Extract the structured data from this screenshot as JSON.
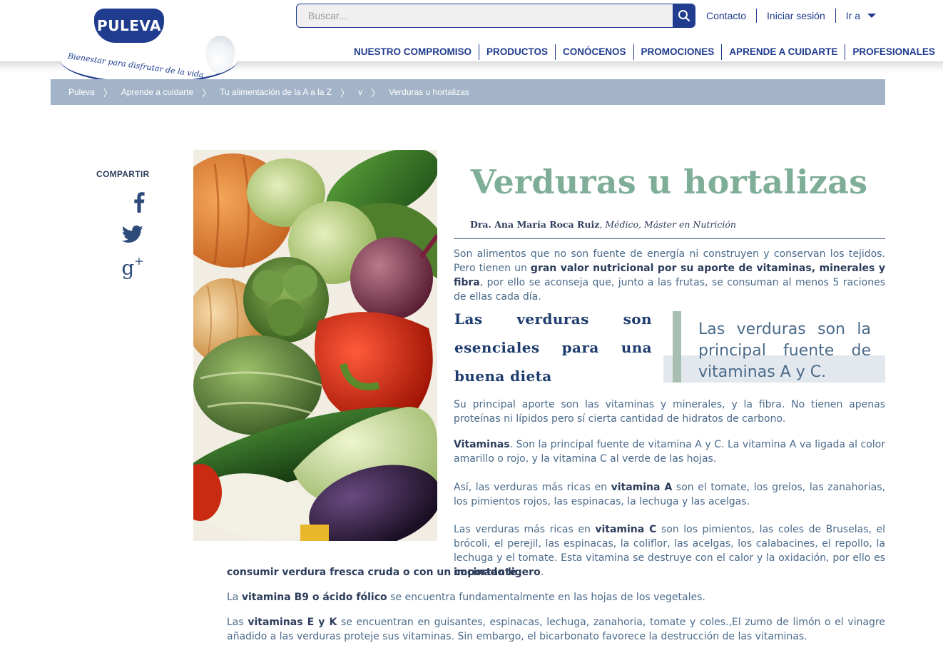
{
  "brand": {
    "logo_text": "PULEVA",
    "tagline": "Bienestar para disfrutar de la vida"
  },
  "search": {
    "placeholder": "Buscar..."
  },
  "top_links": [
    "Contacto",
    "Iniciar sesión",
    "Ir a"
  ],
  "nav": [
    "NUESTRO COMPROMISO",
    "PRODUCTOS",
    "CONÓCENOS",
    "PROMOCIONES",
    "APRENDE A CUIDARTE",
    "PROFESIONALES"
  ],
  "breadcrumb": [
    "Puleva",
    "Aprende a cuidarte",
    "Tu alimentación de la A a la Z",
    "v",
    "Verduras u hortalizas"
  ],
  "share": {
    "title": "COMPARTIR",
    "networks": [
      "facebook-icon",
      "twitter-icon",
      "google-plus-icon"
    ]
  },
  "article": {
    "title": "Verduras u hortalizas",
    "author_name": "Dra. Ana María Roca Ruiz",
    "author_role": ", Médico, Máster en Nutrición",
    "intro": {
      "a": "Son alimentos que no son fuente de energía ni construyen y conservan los tejidos. Pero tienen un ",
      "b": "gran valor nutricional por su aporte de vitaminas, minerales y fibra",
      "c": ", por ello se aconseja que, junto a las frutas, se consuman al menos 5 raciones de ellas cada día."
    },
    "subheading": "Las verduras son esenciales para una buena dieta",
    "quote": "Las verduras son la principal fuente de vitaminas A y C.",
    "p1": "Su principal aporte son las vitaminas y minerales, y la fibra. No tienen apenas proteínas ni lípidos pero sí cierta cantidad de hidratos de carbono.",
    "p2": {
      "b": "Vitaminas",
      "c": ". Son la principal fuente de vitamina A y C. La vitamina A va ligada al color amarillo o rojo, y la vitamina C al verde de las hojas."
    },
    "p3": {
      "a": "Así, las verduras más ricas en ",
      "b": "vitamina A",
      "c": " son el tomate, los grelos, las zanahorias, los pimientos rojos, las espinacas, la lechuga y las acelgas."
    },
    "p4": {
      "a": "Las verduras más ricas en ",
      "b": "vitamina C",
      "c": " son los pimientos, las coles de Bruselas, el brócoli, el perejil, las espinacas, la coliflor, las acelgas, los calabacines, el repollo, la lechuga y el tomate. Esta vitamina se destruye con el calor y la oxidación, por ello es ",
      "d": "importante",
      "e": "consumir verdura fresca cruda o con un cocinado ligero",
      "f": "."
    },
    "p5": {
      "a": "La ",
      "b": "vitamina B9 o ácido fólico",
      "c": " se encuentra fundamentalmente en las hojas de los vegetales."
    },
    "p6": {
      "a": "Las ",
      "b": "vitaminas E y K",
      "c": " se encuentran en guisantes, espinacas, lechuga, zanahoria, tomate y coles.,El zumo de limón o el vinagre añadido a las verduras proteje sus vitaminas. Sin embargo, el bicarbonato favorece la destrucción de las vitaminas."
    }
  },
  "colors": {
    "brand_blue": "#1f3c8e",
    "title_green": "#7fae98",
    "breadcrumb_bg": "#a3b4c8",
    "text_blue": "#4a6a8a"
  }
}
